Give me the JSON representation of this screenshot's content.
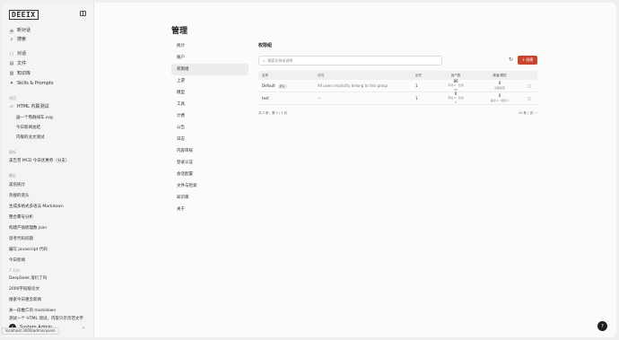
{
  "sidebar": {
    "logo": "DEEIX",
    "top": [
      {
        "icon": "plus-icon",
        "glyph": "+",
        "label": "新对话"
      },
      {
        "icon": "search-icon",
        "glyph": "⌕",
        "label": "搜索"
      }
    ],
    "nav": [
      {
        "icon": "chat-icon",
        "glyph": "◌",
        "label": "对话"
      },
      {
        "icon": "file-icon",
        "glyph": "▤",
        "label": "文件"
      },
      {
        "icon": "book-icon",
        "glyph": "▥",
        "label": "知识库"
      },
      {
        "icon": "sparkle-icon",
        "glyph": "✦",
        "label": "Skills & Prompts"
      }
    ],
    "section_projects": "项目",
    "project": {
      "icon": "folder-icon",
      "glyph": "▱",
      "label": "HTML 内联测试"
    },
    "project_children": [
      "画一个熊群阔车.svg",
      "今日新闻总结",
      "内联的龙文测试"
    ],
    "section_starred": "星标",
    "starred": [
      "美告劳 MCD 今日优惠券（分支）"
    ],
    "section_recent": "最近",
    "recent": [
      "美伤统计",
      "热搜的谣头",
      "生成多格式多语法 Markdown",
      "整合雾号分析",
      "构建产值梳理数 json",
      "思考代码问题",
      "编写 javascript 代码",
      "今日新闻"
    ],
    "section_earlier": "7 天内",
    "earlier": [
      "DeepSeek 溶衍了吗",
      "2000字班级论文",
      "搜索今日重念新闻",
      "关一段推仁的 markdown",
      "测试一个 HTML 测试，内容只示示范文字"
    ],
    "user": {
      "avatar": "S",
      "name": "System Admin"
    },
    "status_url": "localhost:3000/admin/users"
  },
  "main": {
    "title": "管理",
    "nav": [
      "统计",
      "账户",
      "权限组",
      "上游",
      "模型",
      "工具",
      "计费",
      "公告",
      "日志",
      "内容审核",
      "登录认证",
      "会话配置",
      "文件与检索",
      "知识库",
      "关于"
    ],
    "active_nav_index": 2,
    "section_title": "权限组",
    "search_placeholder": "搜索名称或说明",
    "create_label": "+ 创建",
    "table": {
      "headers": [
        "名称",
        "说明",
        "优先",
        "用户数",
        "渠道/模型",
        ""
      ],
      "rows": [
        {
          "name": "Default",
          "badge": "默认",
          "desc": "All users implicitly belong to this group",
          "priority": "1",
          "users_big": "86",
          "users_small": "手动 0 · 隐含 86",
          "models_big": "0",
          "models_small": "全部模型"
        },
        {
          "name": "test",
          "badge": "",
          "desc": "—",
          "priority": "1",
          "users_big": "0",
          "users_small": "手动 0 · 隐含 0",
          "models_big": "0",
          "models_small": "渠道 0 · 模型 0"
        }
      ]
    },
    "footer_left": "共 2 条，第 1 / 1 页",
    "footer_right": "20 条 / 页"
  },
  "help_label": "?"
}
